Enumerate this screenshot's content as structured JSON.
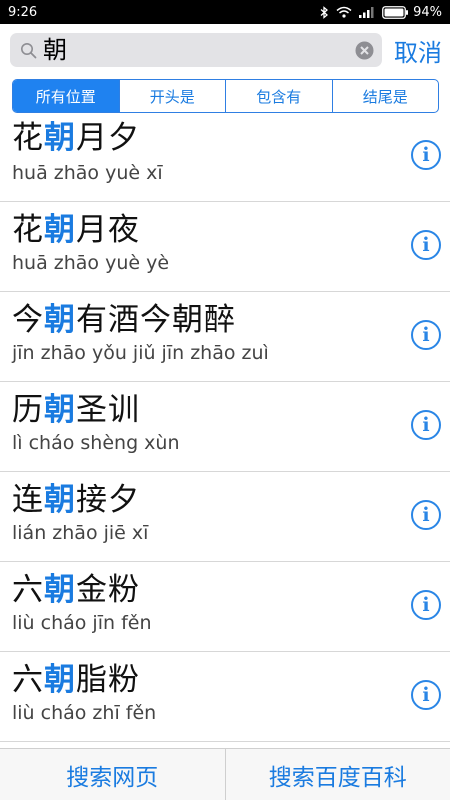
{
  "status": {
    "time": "9:26",
    "battery": "94%"
  },
  "search": {
    "query": "朝",
    "cancel_label": "取消"
  },
  "segments": [
    {
      "label": "所有位置"
    },
    {
      "label": "开头是"
    },
    {
      "label": "包含有"
    },
    {
      "label": "结尾是"
    }
  ],
  "results": [
    {
      "pre": "花",
      "hl": "朝",
      "post": "月夕",
      "pinyin": "huā zhāo yuè xī"
    },
    {
      "pre": "花",
      "hl": "朝",
      "post": "月夜",
      "pinyin": "huā zhāo yuè yè"
    },
    {
      "pre": "今",
      "hl": "朝",
      "post": "有酒今朝醉",
      "pinyin": "jīn zhāo yǒu jiǔ jīn zhāo zuì"
    },
    {
      "pre": "历",
      "hl": "朝",
      "post": "圣训",
      "pinyin": "lì cháo shèng xùn"
    },
    {
      "pre": "连",
      "hl": "朝",
      "post": "接夕",
      "pinyin": "lián zhāo jiē xī"
    },
    {
      "pre": "六",
      "hl": "朝",
      "post": "金粉",
      "pinyin": "liù cháo jīn fěn"
    },
    {
      "pre": "六",
      "hl": "朝",
      "post": "脂粉",
      "pinyin": "liù cháo zhī fěn"
    }
  ],
  "bottom": {
    "web_search": "搜索网页",
    "baidu_search": "搜索百度百科"
  },
  "icons": {
    "info": "i"
  },
  "colors": {
    "accent": "#1a7be0",
    "status_bar": "#000000"
  }
}
